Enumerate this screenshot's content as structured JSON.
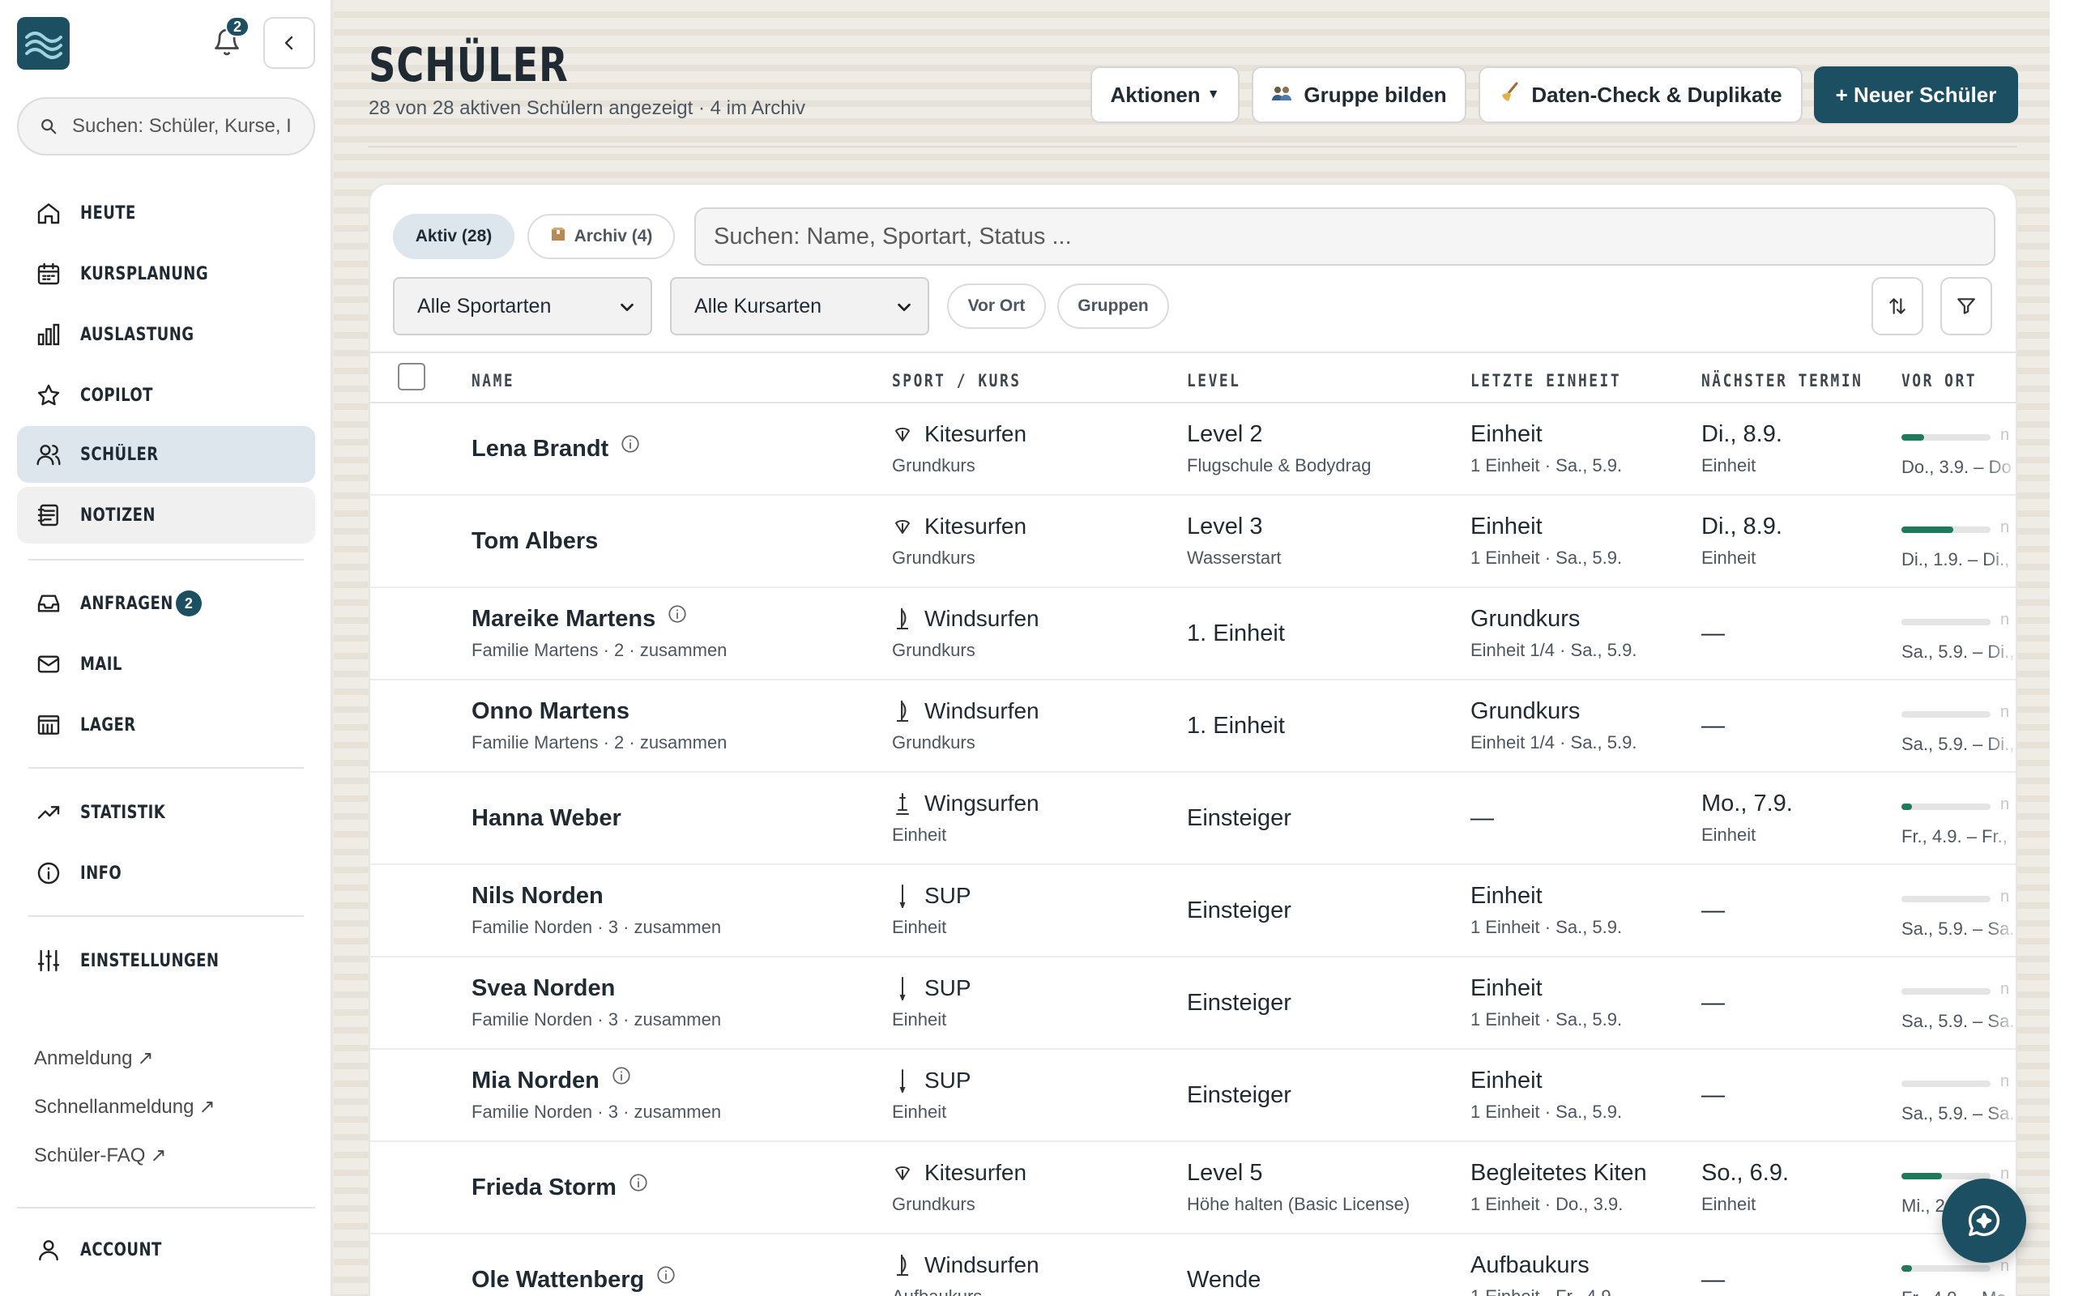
{
  "sidebar": {
    "notification_count": "2",
    "search_placeholder": "Suchen: Schüler, Kurse, I",
    "nav": [
      {
        "label": "HEUTE",
        "icon": "home-icon"
      },
      {
        "label": "KURSPLANUNG",
        "icon": "calendar-icon"
      },
      {
        "label": "AUSLASTUNG",
        "icon": "bar-chart-icon"
      },
      {
        "label": "COPILOT",
        "icon": "star-icon"
      },
      {
        "label": "SCHÜLER",
        "icon": "users-icon"
      },
      {
        "label": "NOTIZEN",
        "icon": "notes-icon"
      },
      {
        "label": "ANFRAGEN",
        "icon": "inbox-icon",
        "badge": "2"
      },
      {
        "label": "MAIL",
        "icon": "mail-icon"
      },
      {
        "label": "LAGER",
        "icon": "warehouse-icon"
      },
      {
        "label": "STATISTIK",
        "icon": "trend-icon"
      },
      {
        "label": "INFO",
        "icon": "info-icon"
      },
      {
        "label": "EINSTELLUNGEN",
        "icon": "sliders-icon"
      }
    ],
    "links": [
      "Anmeldung",
      "Schnellanmeldung",
      "Schüler-FAQ"
    ],
    "account_label": "ACCOUNT"
  },
  "header": {
    "title": "SCHÜLER",
    "subtitle": "28 von 28 aktiven Schülern angezeigt · 4 im Archiv",
    "actions_label": "Aktionen",
    "group_label": "Gruppe bilden",
    "datacheck_label": "Daten-Check & Duplikate",
    "new_label": "+ Neuer Schüler"
  },
  "filters": {
    "tab_active": "Aktiv (28)",
    "tab_archive": "Archiv (4)",
    "search_placeholder": "Suchen: Name, Sportart, Status ...",
    "sport_select": "Alle Sportarten",
    "course_select": "Alle Kursarten",
    "chip_onsite": "Vor Ort",
    "chip_groups": "Gruppen"
  },
  "table": {
    "columns": [
      "NAME",
      "SPORT / KURS",
      "LEVEL",
      "LETZTE EINHEIT",
      "NÄCHSTER TERMIN",
      "VOR ORT"
    ],
    "rows": [
      {
        "name": "Lena Brandt",
        "info": true,
        "name_sub": "",
        "sport": "Kitesurfen",
        "sport_icon": "kite-icon",
        "course": "Grundkurs",
        "level": "Level 2",
        "level_sub": "Flugschule & Bodydrag",
        "last": "Einheit",
        "last_sub": "1 Einheit · Sa., 5.9.",
        "next": "Di., 8.9.",
        "next_sub": "Einheit",
        "onsite_progress": 0.25,
        "onsite_range": "Do., 3.9. – Do"
      },
      {
        "name": "Tom Albers",
        "info": false,
        "name_sub": "",
        "sport": "Kitesurfen",
        "sport_icon": "kite-icon",
        "course": "Grundkurs",
        "level": "Level 3",
        "level_sub": "Wasserstart",
        "last": "Einheit",
        "last_sub": "1 Einheit · Sa., 5.9.",
        "next": "Di., 8.9.",
        "next_sub": "Einheit",
        "onsite_progress": 0.58,
        "onsite_range": "Di., 1.9. – Di.,"
      },
      {
        "name": "Mareike Martens",
        "info": true,
        "name_sub": "Familie Martens · 2 · zusammen",
        "sport": "Windsurfen",
        "sport_icon": "windsurf-icon",
        "course": "Grundkurs",
        "level": "1. Einheit",
        "level_sub": "",
        "last": "Grundkurs",
        "last_sub": "Einheit 1/4 · Sa., 5.9.",
        "next": "—",
        "next_sub": "",
        "onsite_progress": 0,
        "onsite_range": "Sa., 5.9. – Di.,"
      },
      {
        "name": "Onno Martens",
        "info": false,
        "name_sub": "Familie Martens · 2 · zusammen",
        "sport": "Windsurfen",
        "sport_icon": "windsurf-icon",
        "course": "Grundkurs",
        "level": "1. Einheit",
        "level_sub": "",
        "last": "Grundkurs",
        "last_sub": "Einheit 1/4 · Sa., 5.9.",
        "next": "—",
        "next_sub": "",
        "onsite_progress": 0,
        "onsite_range": "Sa., 5.9. – Di.,"
      },
      {
        "name": "Hanna Weber",
        "info": false,
        "name_sub": "",
        "sport": "Wingsurfen",
        "sport_icon": "wingsurf-icon",
        "course": "Einheit",
        "level": "Einsteiger",
        "level_sub": "",
        "last": "—",
        "last_sub": "",
        "next": "Mo., 7.9.",
        "next_sub": "Einheit",
        "onsite_progress": 0.12,
        "onsite_range": "Fr., 4.9. – Fr.,"
      },
      {
        "name": "Nils Norden",
        "info": false,
        "name_sub": "Familie Norden · 3 · zusammen",
        "sport": "SUP",
        "sport_icon": "sup-icon",
        "course": "Einheit",
        "level": "Einsteiger",
        "level_sub": "",
        "last": "Einheit",
        "last_sub": "1 Einheit · Sa., 5.9.",
        "next": "—",
        "next_sub": "",
        "onsite_progress": 0,
        "onsite_range": "Sa., 5.9. – Sa."
      },
      {
        "name": "Svea Norden",
        "info": false,
        "name_sub": "Familie Norden · 3 · zusammen",
        "sport": "SUP",
        "sport_icon": "sup-icon",
        "course": "Einheit",
        "level": "Einsteiger",
        "level_sub": "",
        "last": "Einheit",
        "last_sub": "1 Einheit · Sa., 5.9.",
        "next": "—",
        "next_sub": "",
        "onsite_progress": 0,
        "onsite_range": "Sa., 5.9. – Sa."
      },
      {
        "name": "Mia Norden",
        "info": true,
        "name_sub": "Familie Norden · 3 · zusammen",
        "sport": "SUP",
        "sport_icon": "sup-icon",
        "course": "Einheit",
        "level": "Einsteiger",
        "level_sub": "",
        "last": "Einheit",
        "last_sub": "1 Einheit · Sa., 5.9.",
        "next": "—",
        "next_sub": "",
        "onsite_progress": 0,
        "onsite_range": "Sa., 5.9. – Sa."
      },
      {
        "name": "Frieda Storm",
        "info": true,
        "name_sub": "",
        "sport": "Kitesurfen",
        "sport_icon": "kite-icon",
        "course": "Grundkurs",
        "level": "Level 5",
        "level_sub": "Höhe halten (Basic License)",
        "last": "Begleitetes Kiten",
        "last_sub": "1 Einheit · Do., 3.9.",
        "next": "So., 6.9.",
        "next_sub": "Einheit",
        "onsite_progress": 0.45,
        "onsite_range": "Mi., 2"
      },
      {
        "name": "Ole Wattenberg",
        "info": true,
        "name_sub": "",
        "sport": "Windsurfen",
        "sport_icon": "windsurf-icon",
        "course": "Aufbaukurs",
        "level": "Wende",
        "level_sub": "",
        "last": "Aufbaukurs",
        "last_sub": "1 Einheit · Fr., 4.9.",
        "next": "—",
        "next_sub": "",
        "onsite_progress": 0.12,
        "onsite_range": "Fr., 4.9. – Mo."
      }
    ]
  },
  "colors": {
    "accent": "#1d4f63",
    "progress": "#1f7a5a",
    "active_nav": "#dde6ec"
  }
}
